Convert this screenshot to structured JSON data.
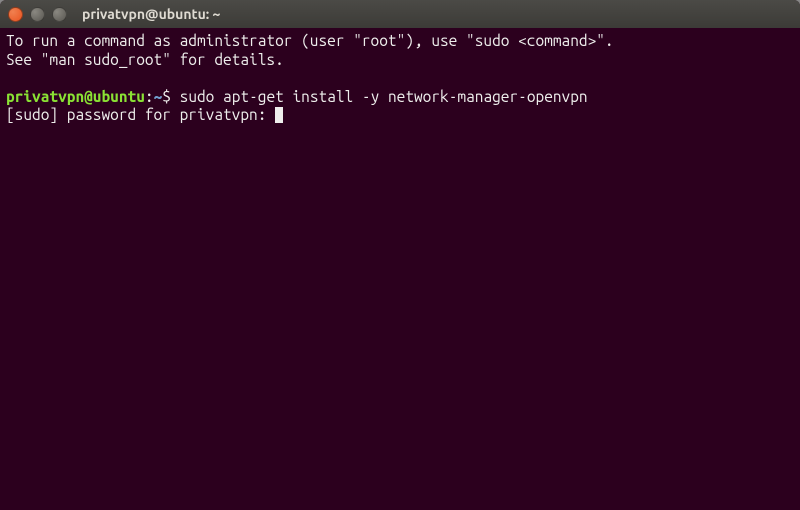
{
  "titlebar": {
    "title": "privatvpn@ubuntu: ~"
  },
  "terminal": {
    "motd_line1": "To run a command as administrator (user \"root\"), use \"sudo <command>\".",
    "motd_line2": "See \"man sudo_root\" for details.",
    "prompt_user_host": "privatvpn@ubuntu",
    "prompt_sep": ":",
    "prompt_path": "~",
    "prompt_symbol": "$",
    "command": "sudo apt-get install -y network-manager-openvpn",
    "password_prompt": "[sudo] password for privatvpn: "
  }
}
